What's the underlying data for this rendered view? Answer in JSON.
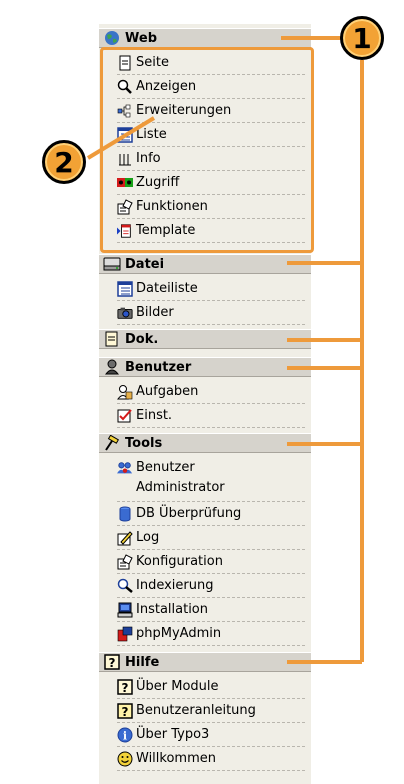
{
  "sections": [
    {
      "label": "Web",
      "icon": "globe-icon",
      "items": [
        {
          "label": "Seite",
          "icon": "page-icon"
        },
        {
          "label": "Anzeigen",
          "icon": "magnifier-icon"
        },
        {
          "label": "Erweiterungen",
          "icon": "tree-icon"
        },
        {
          "label": "Liste",
          "icon": "list-icon"
        },
        {
          "label": "Info",
          "icon": "info-columns-icon"
        },
        {
          "label": "Zugriff",
          "icon": "access-icon"
        },
        {
          "label": "Funktionen",
          "icon": "functions-icon"
        },
        {
          "label": "Template",
          "icon": "template-icon"
        }
      ]
    },
    {
      "label": "Datei",
      "icon": "drive-icon",
      "items": [
        {
          "label": "Dateiliste",
          "icon": "list-icon"
        },
        {
          "label": "Bilder",
          "icon": "camera-icon"
        }
      ]
    },
    {
      "label": "Dok.",
      "icon": "document-icon",
      "items": []
    },
    {
      "label": "Benutzer",
      "icon": "user-icon",
      "items": [
        {
          "label": "Aufgaben",
          "icon": "tasks-icon"
        },
        {
          "label": "Einst.",
          "icon": "checkbox-icon"
        }
      ]
    },
    {
      "label": "Tools",
      "icon": "hammer-icon",
      "items": [
        {
          "label": "Benutzer\nAdministrator",
          "icon": "users-icon"
        },
        {
          "label": "DB Überprüfung",
          "icon": "database-icon"
        },
        {
          "label": "Log",
          "icon": "pencil-icon"
        },
        {
          "label": "Konfiguration",
          "icon": "functions-icon"
        },
        {
          "label": "Indexierung",
          "icon": "magnifier-icon"
        },
        {
          "label": "Installation",
          "icon": "computer-icon"
        },
        {
          "label": "phpMyAdmin",
          "icon": "phpmyadmin-icon"
        }
      ]
    },
    {
      "label": "Hilfe",
      "icon": "help-icon",
      "items": [
        {
          "label": "Über Module",
          "icon": "help-icon"
        },
        {
          "label": "Benutzeranleitung",
          "icon": "help-icon"
        },
        {
          "label": "Über Typo3",
          "icon": "info-icon"
        },
        {
          "label": "Willkommen",
          "icon": "smiley-icon"
        }
      ]
    }
  ],
  "callouts": {
    "one": "1",
    "two": "2"
  },
  "colors": {
    "callout_orange": "#ee9a3b",
    "badge": "#f2a235",
    "section_bg": "#d6d3cc",
    "menu_bg": "#f0eee6"
  }
}
